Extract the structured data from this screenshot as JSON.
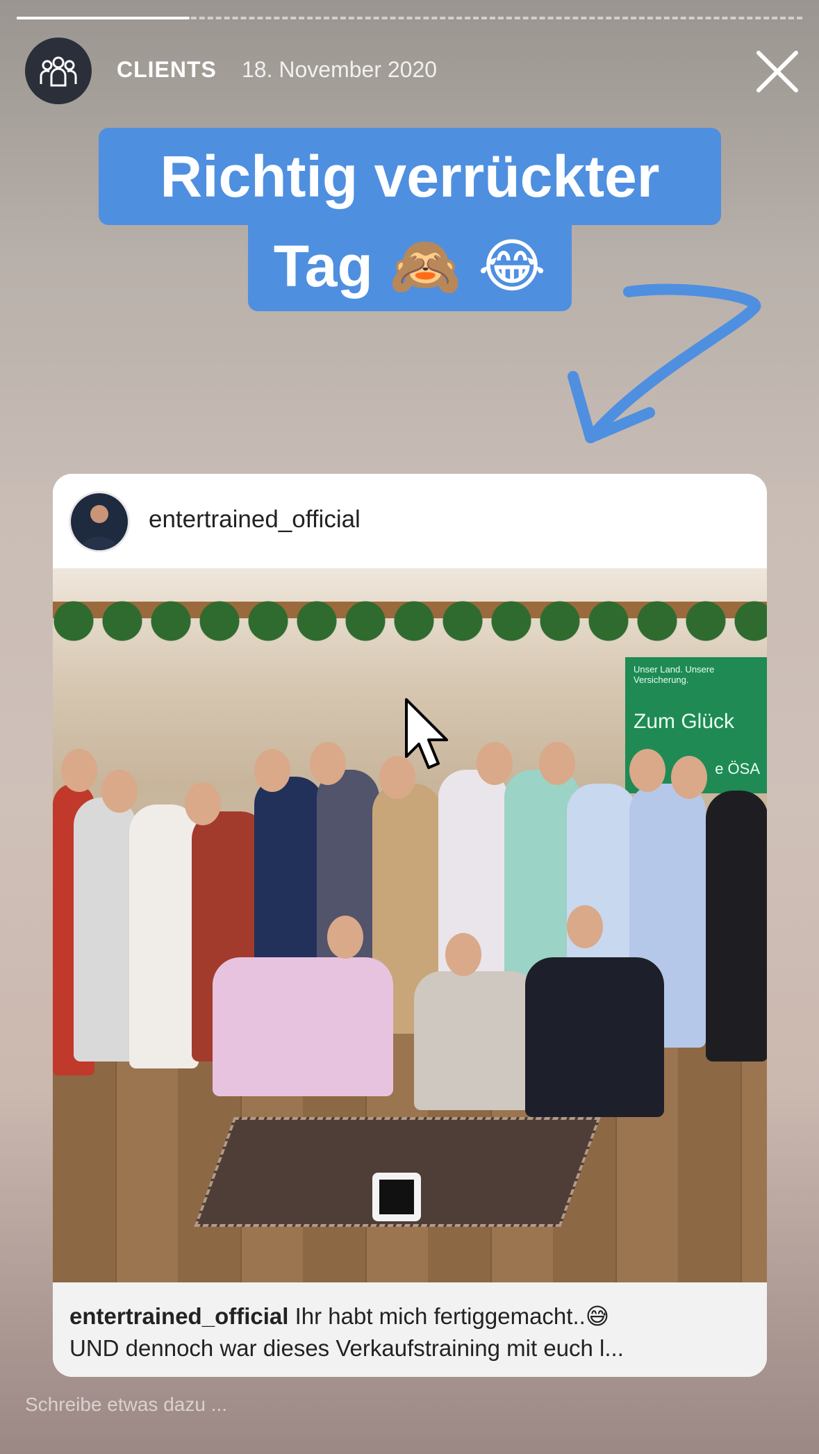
{
  "story": {
    "progress": 0.22,
    "title": "CLIENTS",
    "date": "18. November 2020"
  },
  "text_overlay": {
    "line1": "Richtig verrückter",
    "line2": "Tag 🙈 😂"
  },
  "post": {
    "username": "entertrained_official",
    "banner_line1": "Unser Land. Unsere Versicherung.",
    "banner_line2": "Zum Glück",
    "banner_line3": "e ÖSA",
    "caption_user": "entertrained_official",
    "caption_text": " Ihr habt mich fertiggemacht..😅",
    "caption_line2": "UND dennoch war dieses Verkaufstraining mit euch l..."
  },
  "reply": {
    "placeholder": "Schreibe etwas dazu ..."
  },
  "icons": {
    "avatar": "group-icon",
    "close": "close-icon",
    "arrow": "curved-arrow-icon",
    "cursor": "mouse-pointer-icon"
  },
  "colors": {
    "caption_bg": "#4f8fe0",
    "arrow": "#4f8fe0",
    "banner": "#1f8a54"
  }
}
